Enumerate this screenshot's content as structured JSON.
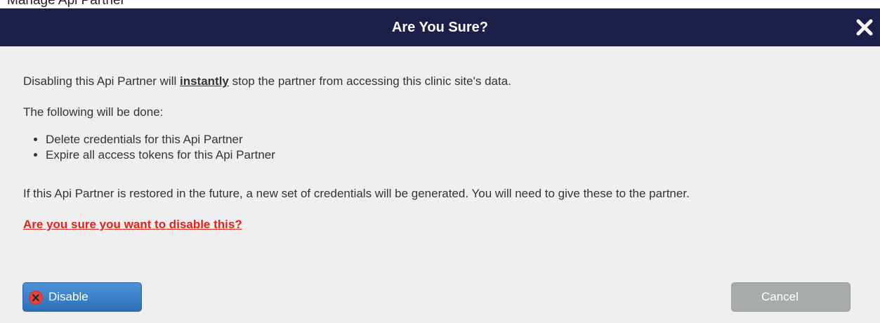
{
  "background_title": "Manage Api Partner",
  "dialog": {
    "title": "Are You Sure?",
    "close_icon": "close-icon",
    "intro_before": "Disabling this Api Partner will ",
    "intro_emphasis": "instantly",
    "intro_after": " stop the partner from accessing this clinic site's data.",
    "following_label": "The following will be done:",
    "actions": [
      "Delete credentials for this Api Partner",
      "Expire all access tokens for this Api Partner"
    ],
    "restore_note": "If this Api Partner is restored in the future, a new set of credentials will be generated. You will need to give these to the partner.",
    "confirm_question": "Are you sure you want to disable this?"
  },
  "buttons": {
    "disable_label": "Disable",
    "disable_icon": "x-circle-icon",
    "cancel_label": "Cancel"
  },
  "colors": {
    "header_bg": "#1c1f4a",
    "warning": "#e2231a",
    "primary_button": "#3a7fca",
    "cancel_button": "#a8abab"
  }
}
